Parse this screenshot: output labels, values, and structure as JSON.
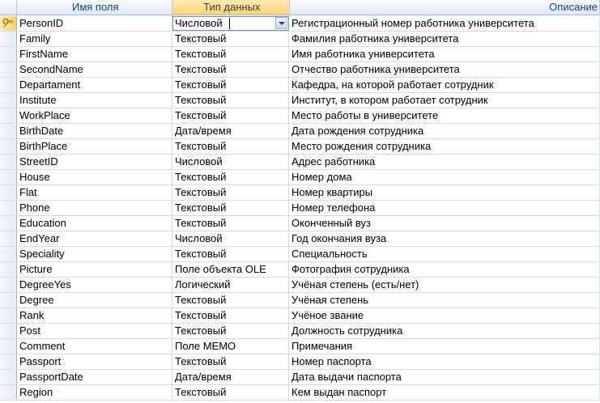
{
  "columns": {
    "field_name": "Имя поля",
    "data_type": "Тип данных",
    "description": "Описание"
  },
  "rows": [
    {
      "field": "PersonID",
      "type": "Числовой",
      "description": "Регистрационный номер работника университета"
    },
    {
      "field": "Family",
      "type": "Текстовый",
      "description": "Фамилия работника университета"
    },
    {
      "field": "FirstName",
      "type": "Текстовый",
      "description": "Имя работника университета"
    },
    {
      "field": "SecondName",
      "type": "Текстовый",
      "description": "Отчество работника университета"
    },
    {
      "field": "Departament",
      "type": "Текстовый",
      "description": "Кафедра, на которой работает сотрудник"
    },
    {
      "field": "Institute",
      "type": "Текстовый",
      "description": "Институт, в котором работает сотрудник"
    },
    {
      "field": "WorkPlace",
      "type": "Текстовый",
      "description": "Место работы в университете"
    },
    {
      "field": "BirthDate",
      "type": "Дата/время",
      "description": "Дата рождения сотрудника"
    },
    {
      "field": "BirthPlace",
      "type": "Текстовый",
      "description": "Место рождения сотрудника"
    },
    {
      "field": "StreetID",
      "type": "Числовой",
      "description": "Адрес работника"
    },
    {
      "field": "House",
      "type": "Текстовый",
      "description": "Номер дома"
    },
    {
      "field": "Flat",
      "type": "Текстовый",
      "description": "Номер квартиры"
    },
    {
      "field": "Phone",
      "type": "Текстовый",
      "description": "Номер телефона"
    },
    {
      "field": "Education",
      "type": "Текстовый",
      "description": "Оконченный вуз"
    },
    {
      "field": "EndYear",
      "type": "Числовой",
      "description": "Год окончания вуза"
    },
    {
      "field": "Speciality",
      "type": "Текстовый",
      "description": "Специальность"
    },
    {
      "field": "Picture",
      "type": "Поле объекта OLE",
      "description": "Фотография сотрудника"
    },
    {
      "field": "DegreeYes",
      "type": "Логический",
      "description": "Учёная степень (есть/нет)"
    },
    {
      "field": "Degree",
      "type": "Текстовый",
      "description": "Учёная степень"
    },
    {
      "field": "Rank",
      "type": "Текстовый",
      "description": "Учёное звание"
    },
    {
      "field": "Post",
      "type": "Текстовый",
      "description": "Должность сотрудника"
    },
    {
      "field": "Comment",
      "type": "Поле MEMO",
      "description": "Примечания"
    },
    {
      "field": "Passport",
      "type": "Текстовый",
      "description": "Номер паспорта"
    },
    {
      "field": "PassportDate",
      "type": "Дата/время",
      "description": "Дата выдачи паспорта"
    },
    {
      "field": "Region",
      "type": "Текстовый",
      "description": "Кем выдан паспорт"
    }
  ],
  "current_row_icon": "primary-key-icon",
  "dropdown_icon": "chevron-down-icon",
  "colors": {
    "header_text": "#15428b",
    "selected_header": "#fbd27a",
    "grid_line": "#d5dde8"
  }
}
